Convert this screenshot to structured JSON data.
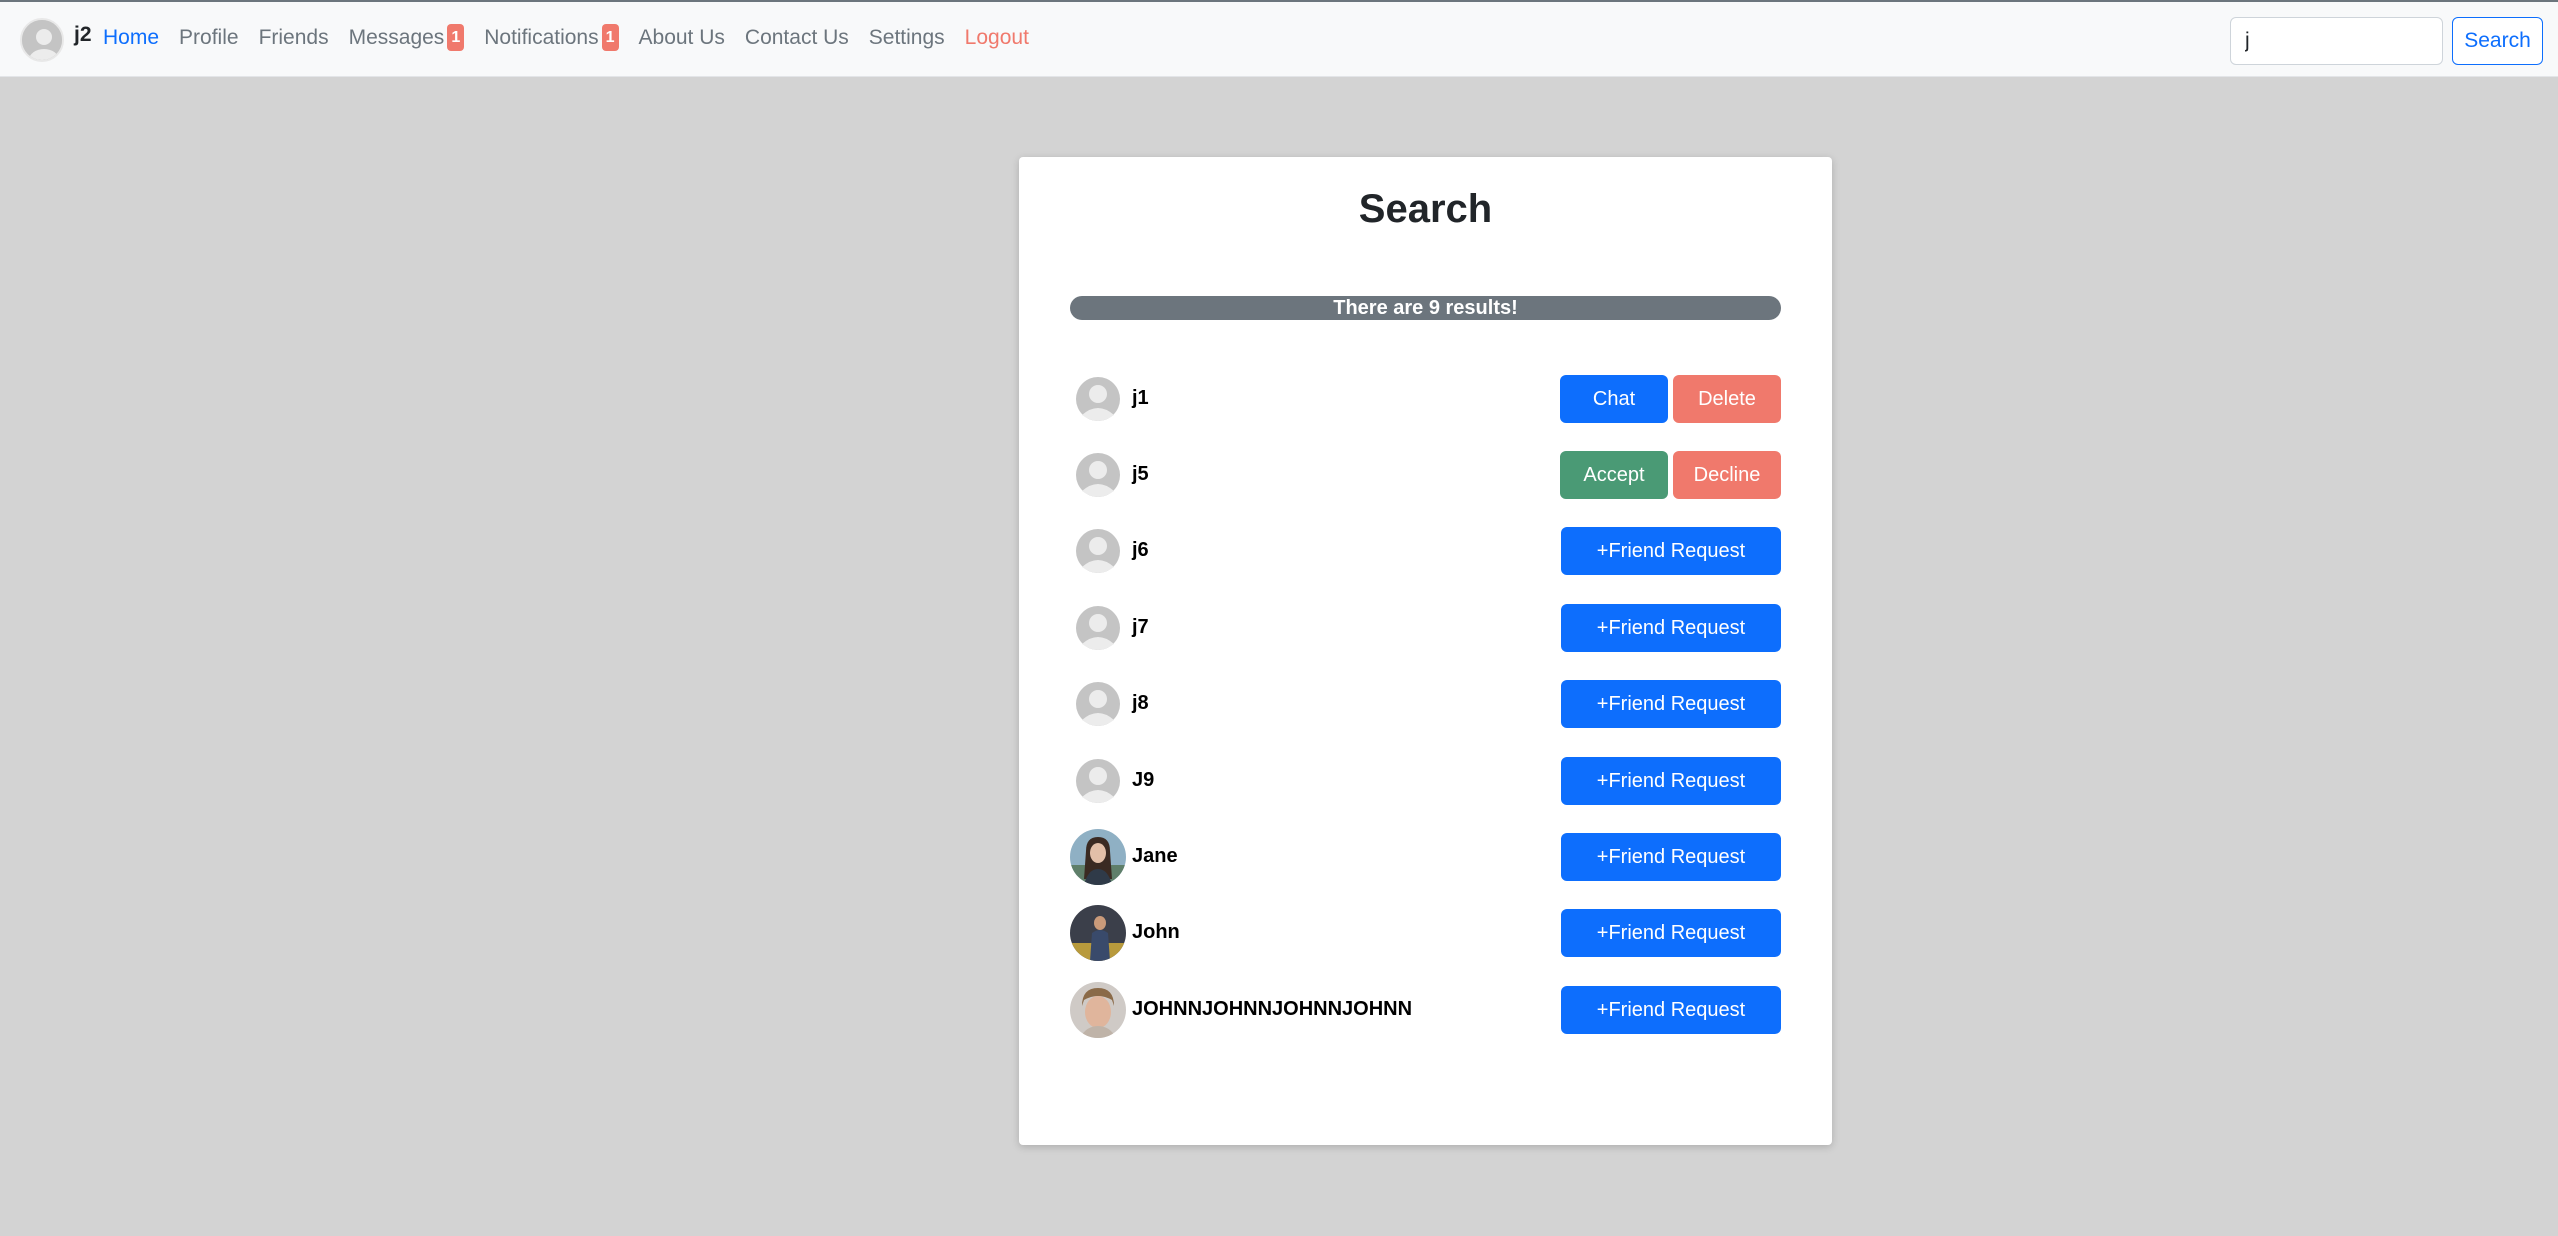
{
  "navbar": {
    "brand": "j2",
    "links": [
      {
        "label": "Home"
      },
      {
        "label": "Profile"
      },
      {
        "label": "Friends"
      },
      {
        "label": "Messages",
        "badge": "1"
      },
      {
        "label": "Notifications",
        "badge": "1"
      },
      {
        "label": "About Us"
      },
      {
        "label": "Contact Us"
      },
      {
        "label": "Settings"
      },
      {
        "label": "Logout"
      }
    ],
    "search_value": "j",
    "search_button": "Search"
  },
  "card": {
    "title": "Search",
    "results_text": "There are 9 results!"
  },
  "results": [
    {
      "name": "j1",
      "avatar": "default-avatar",
      "actions": [
        "Chat",
        "Delete"
      ]
    },
    {
      "name": "j5",
      "avatar": "default-avatar",
      "actions": [
        "Accept",
        "Decline"
      ]
    },
    {
      "name": "j6",
      "avatar": "default-avatar",
      "actions": [
        "+Friend Request"
      ]
    },
    {
      "name": "j7",
      "avatar": "default-avatar",
      "actions": [
        "+Friend Request"
      ]
    },
    {
      "name": "j8",
      "avatar": "default-avatar",
      "actions": [
        "+Friend Request"
      ]
    },
    {
      "name": "J9",
      "avatar": "default-avatar",
      "actions": [
        "+Friend Request"
      ]
    },
    {
      "name": "Jane",
      "avatar": "photo-woman",
      "actions": [
        "+Friend Request"
      ]
    },
    {
      "name": "John",
      "avatar": "photo-man-outdoor",
      "actions": [
        "+Friend Request"
      ]
    },
    {
      "name": "JOHNNJOHNNJOHNNJOHNN",
      "avatar": "photo-man-closeup",
      "actions": [
        "+Friend Request"
      ]
    }
  ],
  "colors": {
    "primary": "#0d6efd",
    "danger": "#f0796c",
    "success": "#4a9a75",
    "secondary": "#6c757d",
    "page_bg": "#d3d3d3"
  }
}
